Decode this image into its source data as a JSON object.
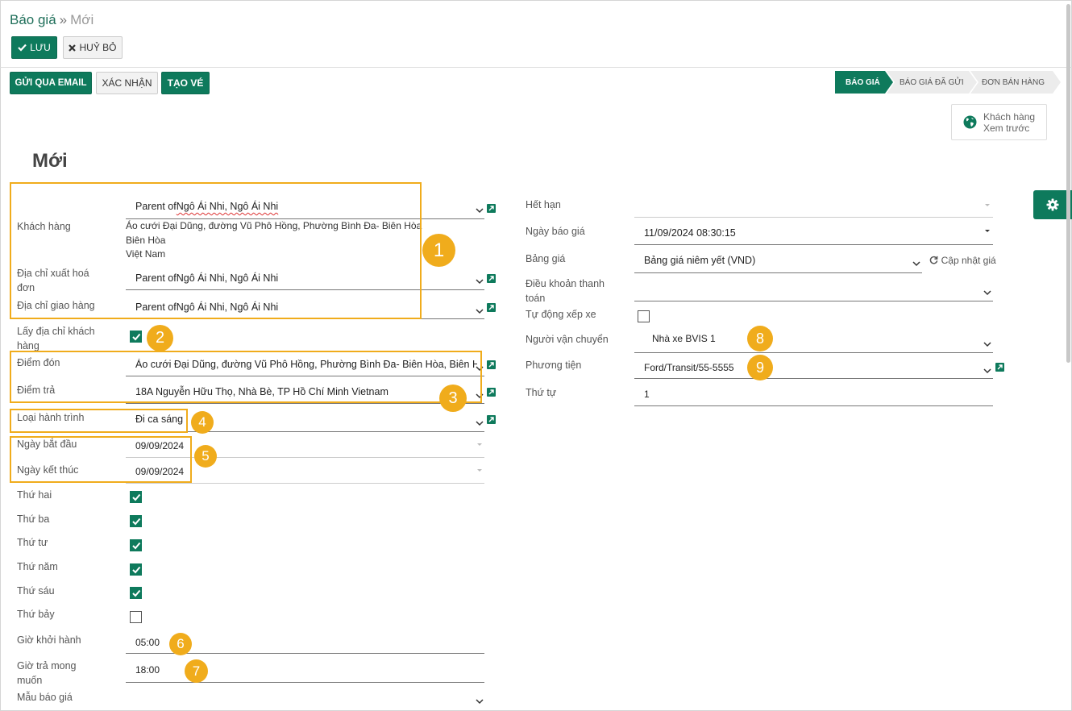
{
  "breadcrumb": {
    "parent": "Báo giá",
    "separator": "»",
    "current": "Mới"
  },
  "top_buttons": {
    "save": "LƯU",
    "discard": "HUỶ BỎ"
  },
  "action_buttons": {
    "send_email": "GỬI QUA EMAIL",
    "confirm": "XÁC NHẬN",
    "create_ticket": "TẠO VÉ"
  },
  "stages": [
    "BÁO GIÁ",
    "BÁO GIÁ ĐÃ GỬI",
    "ĐƠN BÁN HÀNG"
  ],
  "preview": {
    "line1": "Khách hàng",
    "line2": "Xem trước"
  },
  "form": {
    "title": "Mới",
    "left": {
      "customer_label": "Khách hàng",
      "customer_value_prefix": "Parent of",
      "customer_value_name": "Ngô Ái Nhi, Ngô Ái Nhi",
      "customer_address": [
        "Áo cưới Đại Dũng, đường Vũ Phô Hồng, Phường Bình Đa- Biên Hòa",
        "Biên Hòa",
        "Việt Nam"
      ],
      "invoice_address_label_1": "Địa chỉ xuất hoá",
      "invoice_address_label_2": "đơn",
      "invoice_address_value": "Parent ofNgô Ái Nhi, Ngô Ái Nhi",
      "delivery_address_label": "Địa chỉ giao hàng",
      "delivery_address_value": "Parent ofNgô Ái Nhi, Ngô Ái Nhi",
      "use_customer_address_label_1": "Lấy địa chỉ khách",
      "use_customer_address_label_2": "hàng",
      "pickup_label": "Điểm đón",
      "pickup_value": "Áo cưới Đại Dũng, đường Vũ Phô Hồng, Phường Bình Đa- Biên Hòa, Biên Hòa",
      "dropoff_label": "Điểm trả",
      "dropoff_value": "18A Nguyễn Hữu Thọ, Nhà Bè, TP Hồ Chí Minh Vietnam",
      "trip_type_label": "Loại hành trình",
      "trip_type_value": "Đi ca sáng",
      "start_date_label": "Ngày bắt đầu",
      "start_date_value": "09/09/2024",
      "end_date_label": "Ngày kết thúc",
      "end_date_value": "09/09/2024",
      "weekdays": [
        {
          "label": "Thứ hai",
          "checked": true
        },
        {
          "label": "Thứ ba",
          "checked": true
        },
        {
          "label": "Thứ tư",
          "checked": true
        },
        {
          "label": "Thứ năm",
          "checked": true
        },
        {
          "label": "Thứ sáu",
          "checked": true
        },
        {
          "label": "Thứ bảy",
          "checked": false
        }
      ],
      "departure_time_label": "Giờ khởi hành",
      "departure_time_value": "05:00",
      "return_time_label_1": "Giờ trả mong",
      "return_time_label_2": "muốn",
      "return_time_value": "18:00",
      "template_label": "Mẫu báo giá"
    },
    "right": {
      "expiry_label": "Hết hạn",
      "quote_date_label": "Ngày báo giá",
      "quote_date_value": "11/09/2024 08:30:15",
      "pricelist_label": "Bảng giá",
      "pricelist_value": "Bảng giá niêm yết (VND)",
      "update_price": "Cập nhật giá",
      "payment_terms_label_1": "Điều khoản thanh",
      "payment_terms_label_2": "toán",
      "auto_assign_label": "Tự động xếp xe",
      "carrier_label": "Người vận chuyển",
      "carrier_value": "Nhà xe BVIS 1",
      "vehicle_label": "Phương tiện",
      "vehicle_value": "Ford/Transit/55-5555",
      "order_label": "Thứ tự",
      "order_value": "1"
    }
  },
  "annotations": [
    "1",
    "2",
    "3",
    "4",
    "5",
    "6",
    "7",
    "8",
    "9"
  ],
  "colors": {
    "primary": "#0e7a5c",
    "annotation": "#f0ac1c"
  }
}
